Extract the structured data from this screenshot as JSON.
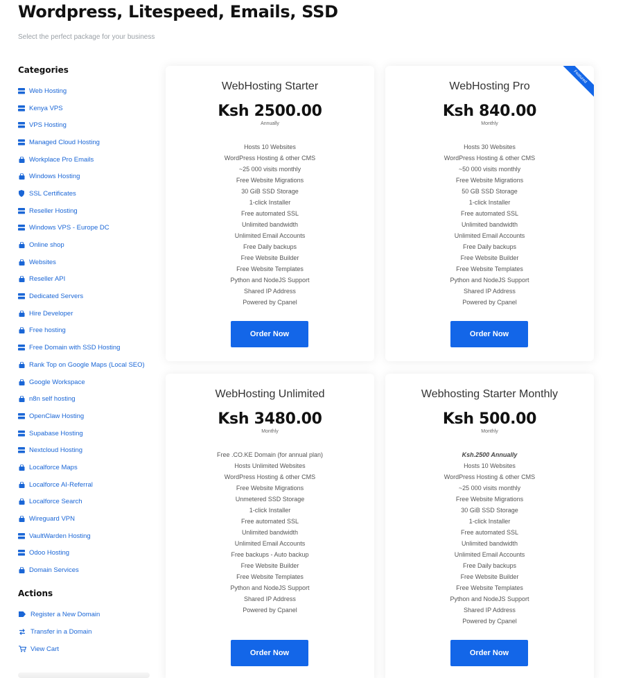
{
  "header": {
    "title": "Wordpress, Litespeed, Emails, SSD",
    "subtitle": "Select the perfect package for your business"
  },
  "sidebar": {
    "categories_heading": "Categories",
    "categories": [
      {
        "label": "Web Hosting",
        "icon": "server-icon"
      },
      {
        "label": "Kenya VPS",
        "icon": "server-icon"
      },
      {
        "label": "VPS Hosting",
        "icon": "server-icon"
      },
      {
        "label": "Managed Cloud Hosting",
        "icon": "server-icon"
      },
      {
        "label": "Workplace Pro Emails",
        "icon": "shopping-bag-icon"
      },
      {
        "label": "Windows Hosting",
        "icon": "shopping-bag-icon"
      },
      {
        "label": "SSL Certificates",
        "icon": "shield-icon"
      },
      {
        "label": "Reseller Hosting",
        "icon": "server-icon"
      },
      {
        "label": "Windows VPS - Europe DC",
        "icon": "server-icon"
      },
      {
        "label": "Online shop",
        "icon": "shopping-bag-icon"
      },
      {
        "label": "Websites",
        "icon": "shopping-bag-icon"
      },
      {
        "label": "Reseller API",
        "icon": "shopping-bag-icon"
      },
      {
        "label": "Dedicated Servers",
        "icon": "server-icon"
      },
      {
        "label": "Hire Developer",
        "icon": "shopping-bag-icon"
      },
      {
        "label": "Free hosting",
        "icon": "shopping-bag-icon"
      },
      {
        "label": "Free Domain with SSD Hosting",
        "icon": "server-icon"
      },
      {
        "label": "Rank Top on Google Maps (Local SEO)",
        "icon": "shopping-bag-icon"
      },
      {
        "label": "Google Workspace",
        "icon": "shopping-bag-icon"
      },
      {
        "label": "n8n self hosting",
        "icon": "shopping-bag-icon"
      },
      {
        "label": "OpenClaw Hosting",
        "icon": "server-icon"
      },
      {
        "label": "Supabase Hosting",
        "icon": "server-icon"
      },
      {
        "label": "Nextcloud Hosting",
        "icon": "server-icon"
      },
      {
        "label": "Localforce Maps",
        "icon": "shopping-bag-icon"
      },
      {
        "label": "Localforce AI-Referral",
        "icon": "shopping-bag-icon"
      },
      {
        "label": "Localforce Search",
        "icon": "shopping-bag-icon"
      },
      {
        "label": "Wireguard VPN",
        "icon": "shopping-bag-icon"
      },
      {
        "label": "VaultWarden Hosting",
        "icon": "server-icon"
      },
      {
        "label": "Odoo Hosting",
        "icon": "server-icon"
      },
      {
        "label": "Domain Services",
        "icon": "shopping-bag-icon"
      }
    ],
    "actions_heading": "Actions",
    "actions": [
      {
        "label": "Register a New Domain",
        "icon": "tag-icon"
      },
      {
        "label": "Transfer in a Domain",
        "icon": "transfer-icon"
      },
      {
        "label": "View Cart",
        "icon": "cart-icon"
      }
    ]
  },
  "products": [
    {
      "name": "WebHosting Starter",
      "price": "Ksh 2500.00",
      "cycle": "Annually",
      "featured": false,
      "features": [
        "Hosts 10 Websites",
        "WordPress Hosting & other CMS",
        "~25 000 visits monthly",
        "Free Website Migrations",
        "30 GiB SSD Storage",
        "1-click Installer",
        "Free automated SSL",
        "Unlimited bandwidth",
        "Unlimited Email Accounts",
        "Free Daily backups",
        "Free Website Builder",
        "Free Website Templates",
        "Python and NodeJS Support",
        "Shared IP Address",
        "Powered by Cpanel"
      ],
      "button": "Order Now"
    },
    {
      "name": "WebHosting Pro",
      "price": "Ksh 840.00",
      "cycle": "Monthly",
      "featured": true,
      "ribbon": "Featured",
      "features": [
        "Hosts 30 Websites",
        "WordPress Hosting & other CMS",
        "~50 000 visits monthly",
        "Free Website Migrations",
        "50 GB SSD Storage",
        "1-click Installer",
        "Free automated SSL",
        "Unlimited bandwidth",
        "Unlimited Email Accounts",
        "Free Daily backups",
        "Free Website Builder",
        "Free Website Templates",
        "Python and NodeJS Support",
        "Shared IP Address",
        "Powered by Cpanel"
      ],
      "button": "Order Now"
    },
    {
      "name": "WebHosting Unlimited",
      "price": "Ksh 3480.00",
      "cycle": "Monthly",
      "featured": false,
      "features": [
        "Free .CO.KE Domain (for annual plan)",
        "Hosts Unlimited Websites",
        "WordPress Hosting & other CMS",
        "Free Website Migrations",
        "Unmetered SSD Storage",
        "1-click Installer",
        "Free automated SSL",
        "Unlimited bandwidth",
        "Unlimited Email Accounts",
        "Free backups - Auto backup",
        "Free Website Builder",
        "Free Website Templates",
        "Python and NodeJS Support",
        "Shared IP Address",
        "Powered by Cpanel"
      ],
      "button": "Order Now"
    },
    {
      "name": "Webhosting Starter Monthly",
      "price": "Ksh 500.00",
      "cycle": "Monthly",
      "featured": false,
      "highlight": "Ksh.2500 Annually",
      "features": [
        "Hosts 10 Websites",
        "WordPress Hosting & other CMS",
        "~25 000 visits monthly",
        "Free Website Migrations",
        "30 GiB SSD Storage",
        "1-click Installer",
        "Free automated SSL",
        "Unlimited bandwidth",
        "Unlimited Email Accounts",
        "Free Daily backups",
        "Free Website Builder",
        "Free Website Templates",
        "Python and NodeJS Support",
        "Shared IP Address",
        "Powered by Cpanel"
      ],
      "button": "Order Now"
    }
  ],
  "colors": {
    "accent": "#1366e8",
    "link": "#1a66d6"
  }
}
